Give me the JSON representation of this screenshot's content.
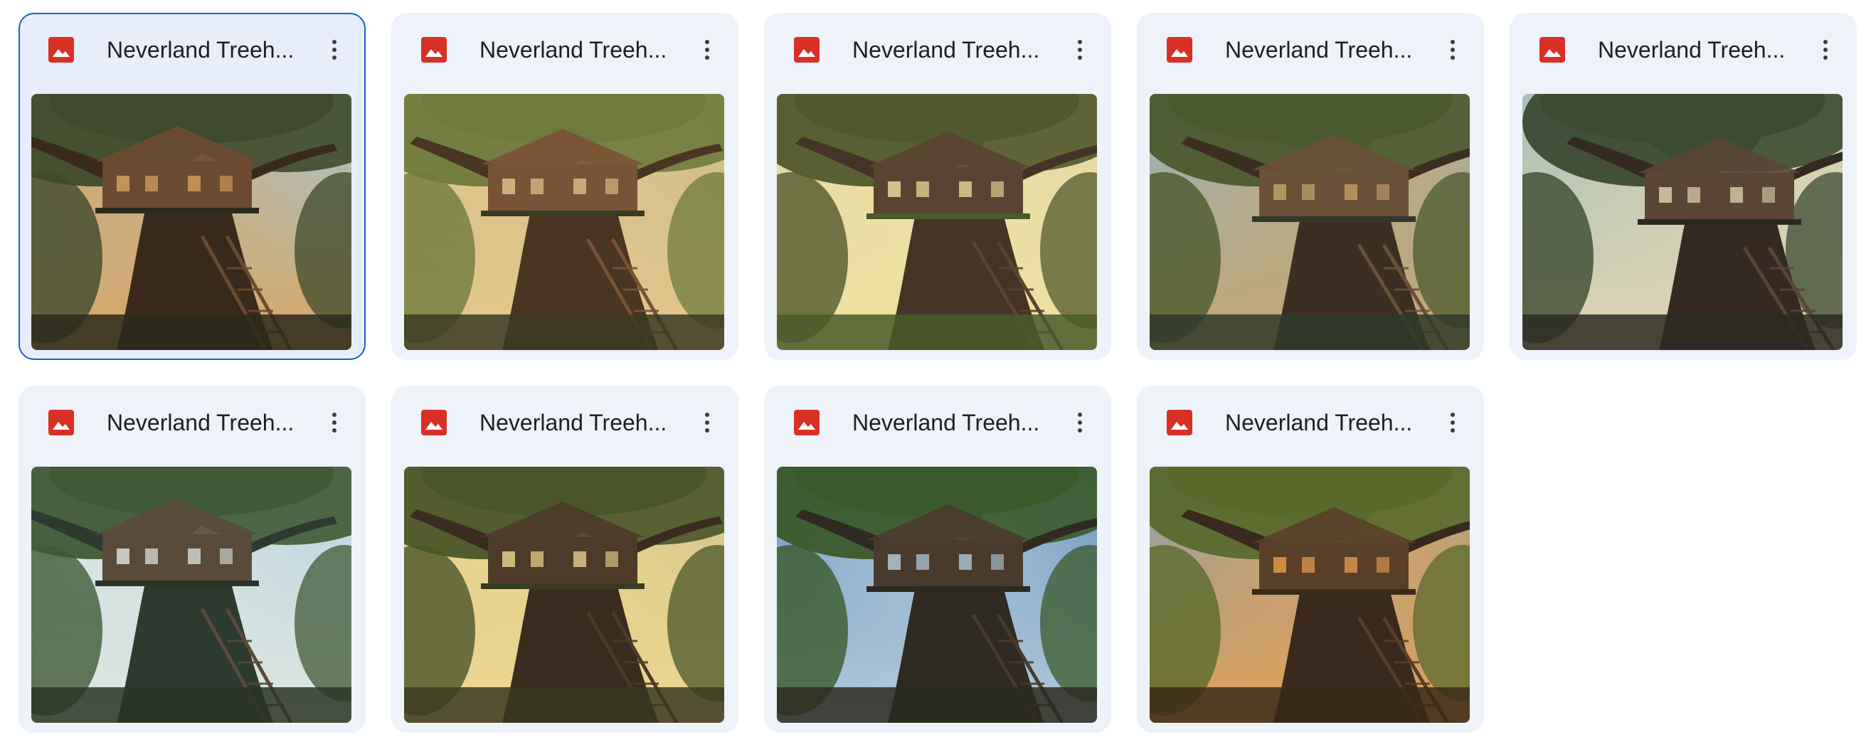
{
  "files": [
    {
      "name": "Neverland Treeh...",
      "selected": true,
      "icon": "image-file-icon",
      "palette": {
        "sky": "#a9c4cf",
        "canopy": "#3e4a2a",
        "tree": "#3a2a1c",
        "house": "#6b4a30",
        "glow": "#d9a560",
        "ground": "#2c2a1c"
      }
    },
    {
      "name": "Neverland Treeh...",
      "selected": false,
      "icon": "image-file-icon",
      "palette": {
        "sky": "#c7b98e",
        "canopy": "#6f7a3c",
        "tree": "#4a3522",
        "house": "#7a5236",
        "glow": "#e6c88a",
        "ground": "#3b3a22"
      }
    },
    {
      "name": "Neverland Treeh...",
      "selected": false,
      "icon": "image-file-icon",
      "palette": {
        "sky": "#d9d3a8",
        "canopy": "#51582c",
        "tree": "#453425",
        "house": "#5a4330",
        "glow": "#f3e2a0",
        "ground": "#4a5a2a"
      }
    },
    {
      "name": "Neverland Treeh...",
      "selected": false,
      "icon": "image-file-icon",
      "palette": {
        "sky": "#8fb4c9",
        "canopy": "#4b5a2c",
        "tree": "#3c2f22",
        "house": "#6a5137",
        "glow": "#c9a56a",
        "ground": "#2f3a2a"
      }
    },
    {
      "name": "Neverland Treeh...",
      "selected": false,
      "icon": "image-file-icon",
      "palette": {
        "sky": "#a7c0b8",
        "canopy": "#3b4a30",
        "tree": "#352a22",
        "house": "#5b4535",
        "glow": "#e3d6b0",
        "ground": "#2b2a22"
      }
    },
    {
      "name": "Neverland Treeh...",
      "selected": false,
      "icon": "image-file-icon",
      "palette": {
        "sky": "#b9d3df",
        "canopy": "#3f5a35",
        "tree": "#2c3a30",
        "house": "#5a4a3a",
        "glow": "#dfe7e0",
        "ground": "#2a3524"
      }
    },
    {
      "name": "Neverland Treeh...",
      "selected": false,
      "icon": "image-file-icon",
      "palette": {
        "sky": "#cfc08a",
        "canopy": "#4a5528",
        "tree": "#3a2c1e",
        "house": "#4e3a28",
        "glow": "#f0d890",
        "ground": "#3a3a20"
      }
    },
    {
      "name": "Neverland Treeh...",
      "selected": false,
      "icon": "image-file-icon",
      "palette": {
        "sky": "#4f7fae",
        "canopy": "#3a5a2a",
        "tree": "#2f2a22",
        "house": "#4a3a2c",
        "glow": "#b8d0e0",
        "ground": "#2a2a1e"
      }
    },
    {
      "name": "Neverland Treeh...",
      "selected": false,
      "icon": "image-file-icon",
      "palette": {
        "sky": "#7fa0b8",
        "canopy": "#5a6a2c",
        "tree": "#3a2a1e",
        "house": "#5a3f28",
        "glow": "#e7a050",
        "ground": "#3a2a18"
      }
    }
  ],
  "colors": {
    "card_bg": "#eef2f9",
    "selected_border": "#1a5fd1",
    "image_icon_red": "#d93025",
    "text": "#1f1f1f"
  }
}
